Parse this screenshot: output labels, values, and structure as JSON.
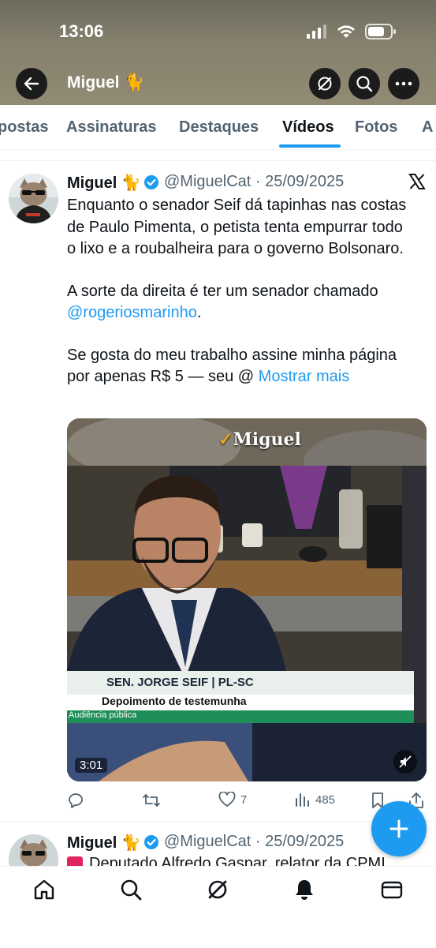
{
  "status_bar": {
    "time": "13:06"
  },
  "header": {
    "title": "Miguel 🐈"
  },
  "tabs": [
    {
      "label": "postas"
    },
    {
      "label": "Assinaturas"
    },
    {
      "label": "Destaques"
    },
    {
      "label": "Vídeos"
    },
    {
      "label": "Fotos"
    },
    {
      "label": "A"
    }
  ],
  "tweet1": {
    "name": "Miguel 🐈",
    "handle": "@MiguelCat · 25/09/2025",
    "paragraph1": "Enquanto o senador Seif dá tapinhas nas costas de Paulo Pimenta, o petista tenta empurrar todo o lixo e a roubalheira para o governo Bolsonaro.",
    "paragraph2_prefix": "A sorte da direita é ter um senador chamado ",
    "mention": "@rogeriosmarinho",
    "paragraph2_suffix": ".",
    "paragraph3": "Se gosta do meu trabalho assine minha página por apenas R$ 5 — seu @ ",
    "show_more": "Mostrar mais",
    "media": {
      "watermark": "Miguel",
      "lower_third_name": "SEN. JORGE SEIF | PL-SC",
      "lower_third_subtitle": "Depoimento de testemunha",
      "lower_third_tag": "Audiência pública",
      "duration": "3:01"
    },
    "stats": {
      "likes": "7",
      "views": "485"
    }
  },
  "tweet2": {
    "name": "Miguel 🐈",
    "handle": "@MiguelCat · 25/09/2025",
    "text": "Deputado Alfredo Gaspar, relator da CPMI"
  },
  "colors": {
    "accent": "#1d9bf0",
    "text": "#0f1419",
    "muted": "#536471"
  }
}
